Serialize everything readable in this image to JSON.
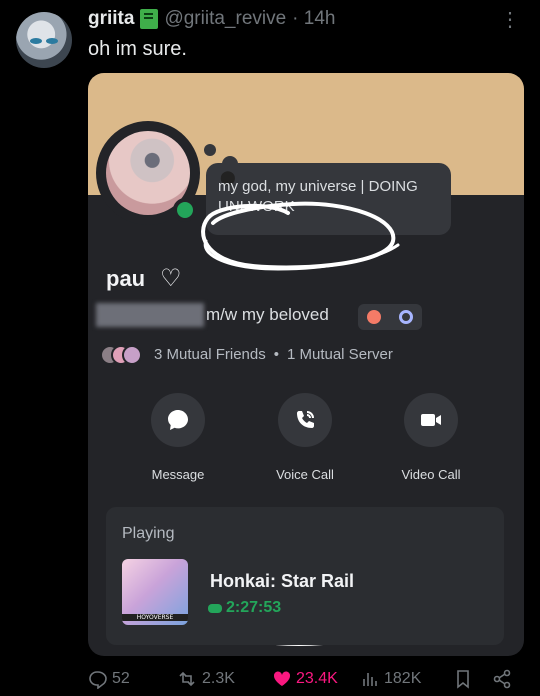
{
  "tweet": {
    "author_name": "griita",
    "author_handle": "@griita_revive",
    "time": "· 14h",
    "text": "oh im sure.",
    "more_glyph": "⋮"
  },
  "profile": {
    "status_emoji": "⬤",
    "status_text": "my god, my universe | DOING UNI WORK",
    "display_name": "pau",
    "heart_glyph": "♡",
    "pronoun_text": "m/w my beloved",
    "mutual_friends": "3 Mutual Friends",
    "mutual_separator": "•",
    "mutual_servers": "1 Mutual Server"
  },
  "actions": {
    "message": "Message",
    "voice_call": "Voice Call",
    "video_call": "Video Call"
  },
  "playing": {
    "header": "Playing",
    "game_name": "Honkai: Star Rail",
    "elapsed": "2:27:53",
    "art_label": "HOYOVERSE"
  },
  "metrics": {
    "replies": "52",
    "reposts": "2.3K",
    "likes": "23.4K",
    "views": "182K"
  },
  "colors": {
    "background": "#000000",
    "card": "#232428",
    "banner": "#dbb98a",
    "online": "#23a55a",
    "like": "#f91880"
  }
}
